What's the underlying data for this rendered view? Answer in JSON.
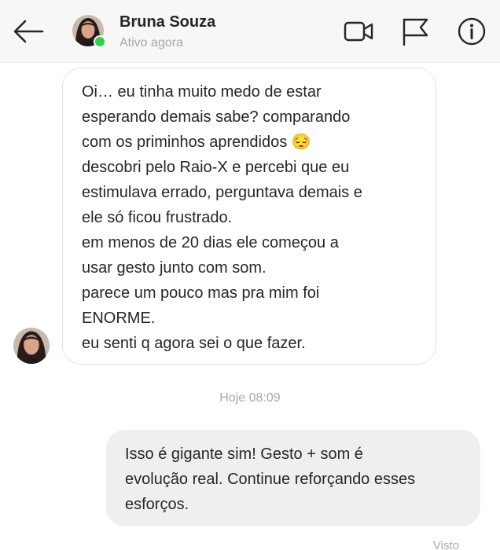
{
  "header": {
    "contact_name": "Bruna Souza",
    "status": "Ativo agora",
    "icons": [
      "back-arrow-icon",
      "video-camera-icon",
      "flag-icon",
      "info-icon"
    ],
    "online_color": "#2fd04b"
  },
  "messages": {
    "incoming": {
      "lines": [
        "Oi… eu tinha muito medo de estar",
        "esperando demais sabe? comparando",
        "com os priminhos aprendidos 😔",
        "descobri pelo Raio-X e percebi que eu",
        "estimulava errado, perguntava demais e",
        "ele só ficou frustrado.",
        "em menos de 20 dias ele começou a",
        "usar gesto junto com som.",
        "parece um pouco mas pra mim foi",
        "ENORME.",
        "eu senti q agora sei o que fazer."
      ]
    },
    "timestamp": "Hoje 08:09",
    "outgoing": {
      "lines": [
        "Isso é gigante sim! Gesto + som é",
        "evolução real. Continue reforçando esses",
        "esforços."
      ]
    },
    "seen_label": "Visto"
  }
}
